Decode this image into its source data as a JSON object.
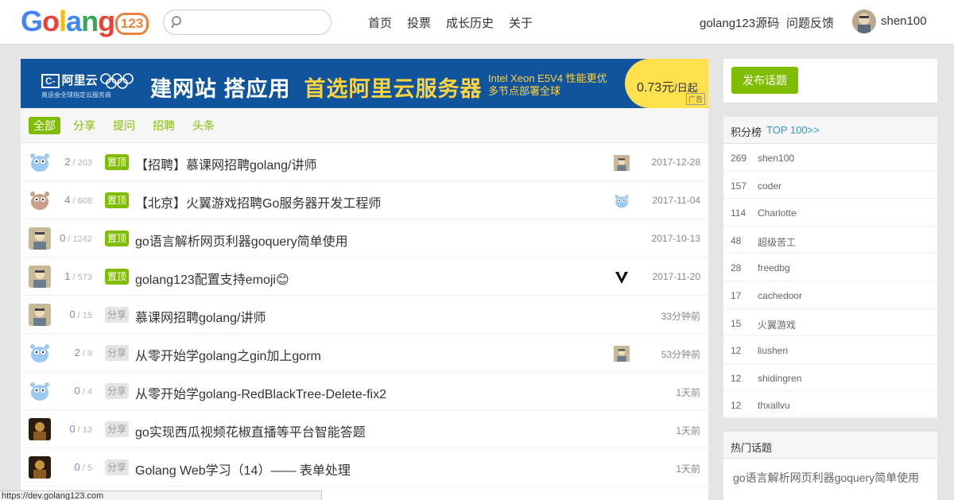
{
  "header": {
    "logo_text": "Golang",
    "logo_badge": "123",
    "search_placeholder": "",
    "nav": [
      "首页",
      "投票",
      "成长历史",
      "关于"
    ],
    "source_link": "golang123源码",
    "feedback_link": "问题反馈",
    "username": "shen100"
  },
  "ad": {
    "brand": "阿里云",
    "brand_sub": "奥运会全球指定云服务商",
    "headline_1": "建网站 搭应用",
    "headline_2": "首选阿里云服务器",
    "intel_line1": "Intel Xeon E5V4 性能更优",
    "intel_line2": "多节点部署全球",
    "price": "0.73元",
    "price_unit": "/日起",
    "tag": "广告"
  },
  "tabs": [
    "全部",
    "分享",
    "提问",
    "招聘",
    "头条"
  ],
  "topics": [
    {
      "reply": "2",
      "view": "203",
      "tag": "置顶",
      "tag_type": "top",
      "title": "【招聘】慕课网招聘golang/讲师",
      "time": "2017-12-28",
      "avatar": "gopher-blue",
      "last": "user-photo"
    },
    {
      "reply": "4",
      "view": "608",
      "tag": "置顶",
      "tag_type": "top",
      "title": "【北京】火翼游戏招聘Go服务器开发工程师",
      "time": "2017-11-04",
      "avatar": "gopher-brown",
      "last": "gopher-blue"
    },
    {
      "reply": "0",
      "view": "1242",
      "tag": "置顶",
      "tag_type": "top",
      "title": "go语言解析网页利器goquery简单使用",
      "time": "2017-10-13",
      "avatar": "user-photo",
      "last": ""
    },
    {
      "reply": "1",
      "view": "573",
      "tag": "置顶",
      "tag_type": "top",
      "title": "golang123配置支持emoji😊",
      "time": "2017-11-20",
      "avatar": "user-photo",
      "last": "v-logo"
    },
    {
      "reply": "0",
      "view": "15",
      "tag": "分享",
      "tag_type": "share",
      "title": "慕课网招聘golang/讲师",
      "time": "33分钟前",
      "avatar": "user-photo",
      "last": ""
    },
    {
      "reply": "2",
      "view": "9",
      "tag": "分享",
      "tag_type": "share",
      "title": "从零开始学golang之gin加上gorm",
      "time": "53分钟前",
      "avatar": "gopher-blue",
      "last": "user-photo"
    },
    {
      "reply": "0",
      "view": "4",
      "tag": "分享",
      "tag_type": "share",
      "title": "从零开始学golang-RedBlackTree-Delete-fix2",
      "time": "1天前",
      "avatar": "gopher-blue",
      "last": ""
    },
    {
      "reply": "0",
      "view": "13",
      "tag": "分享",
      "tag_type": "share",
      "title": "go实现西瓜视频花椒直播等平台智能答题",
      "time": "1天前",
      "avatar": "dark-photo",
      "last": ""
    },
    {
      "reply": "0",
      "view": "5",
      "tag": "分享",
      "tag_type": "share",
      "title": "Golang Web学习（14）—— 表单处理",
      "time": "1天前",
      "avatar": "dark-photo",
      "last": ""
    }
  ],
  "sidebar": {
    "post_button": "发布话题",
    "rank_title": "积分榜",
    "rank_more": "TOP 100>>",
    "rank": [
      {
        "score": "269",
        "name": "shen100"
      },
      {
        "score": "157",
        "name": "coder"
      },
      {
        "score": "114",
        "name": "Charlotte"
      },
      {
        "score": "48",
        "name": "超级苦工"
      },
      {
        "score": "28",
        "name": "freedbg"
      },
      {
        "score": "17",
        "name": "cachedoor"
      },
      {
        "score": "15",
        "name": "火翼游戏"
      },
      {
        "score": "12",
        "name": "liushen"
      },
      {
        "score": "12",
        "name": "shidingren"
      },
      {
        "score": "12",
        "name": "thxallvu"
      }
    ],
    "hot_title": "热门话题",
    "hot_item": "go语言解析网页利器goquery简单使用"
  },
  "statusbar": "https://dev.golang123.com",
  "colors": {
    "accent": "#80bd01",
    "link": "#2f96d6",
    "ad_blue": "#10549e"
  }
}
